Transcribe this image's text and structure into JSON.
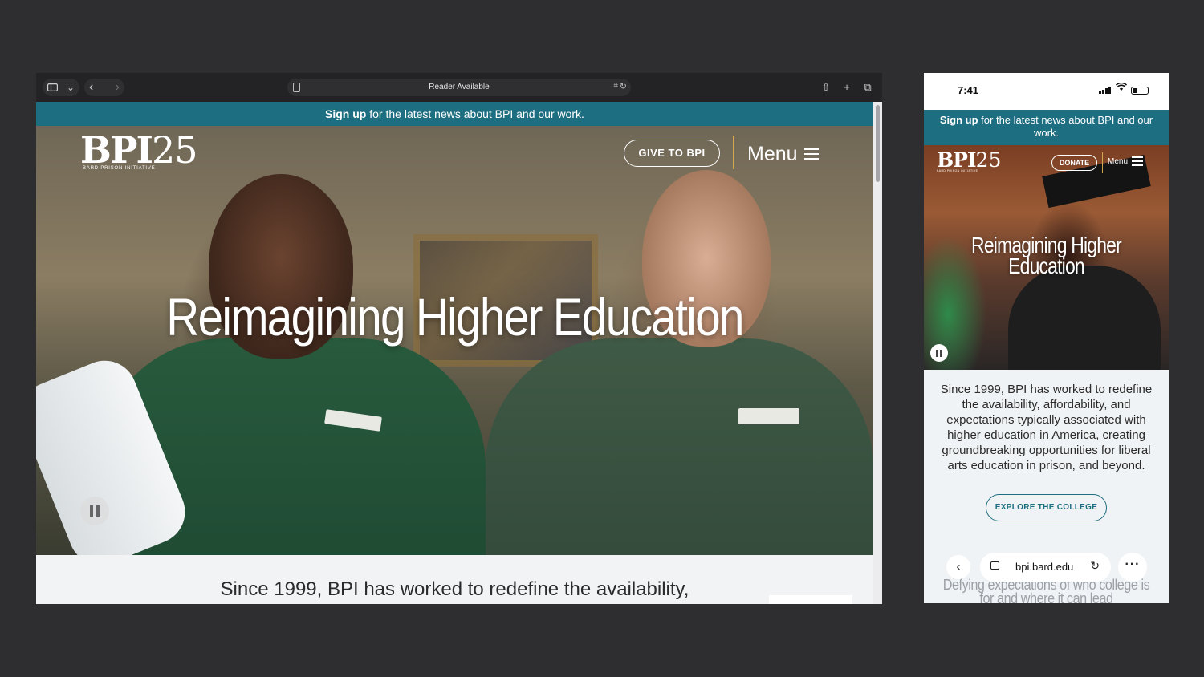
{
  "desktop": {
    "toolbar": {
      "sidebar_icon": "sidebar-icon",
      "chevron": "⌄",
      "back": "‹",
      "forward": "›",
      "address_text": "Reader Available",
      "translate": "⌗",
      "reload": "↻",
      "share": "⇧",
      "new_tab": "+",
      "tabs": "⧉"
    },
    "banner": {
      "bold": "Sign up",
      "text": " for the latest news about BPI and our work."
    },
    "logo": {
      "mark": "BPI",
      "number": "25",
      "subtitle": "BARD PRISON INITIATIVE"
    },
    "nav": {
      "give_label": "GIVE TO BPI",
      "menu_label": "Menu"
    },
    "hero_title": "Reimagining Higher Education",
    "intro_text": "Since 1999, BPI has worked to redefine the availability,"
  },
  "mobile": {
    "status": {
      "time": "7:41",
      "wifi": "wifi-icon",
      "battery": "battery-icon"
    },
    "banner": {
      "bold": "Sign up",
      "text": " for the latest news about BPI and our work."
    },
    "logo": {
      "mark": "BPI",
      "number": "25",
      "subtitle": "BARD PRISON INITIATIVE"
    },
    "nav": {
      "donate_label": "DONATE",
      "menu_label": "Menu"
    },
    "hero_title": "Reimagining Higher Education",
    "intro_text": "Since 1999, BPI has worked to redefine the availability, affordability, and expectations typically associated with higher education in America, creating groundbreaking opportunities for liberal arts education in prison, and beyond.",
    "explore_label": "EXPLORE THE COLLEGE",
    "browser": {
      "back": "‹",
      "domain": "bpi.bard.edu",
      "reload": "↻",
      "more": "···"
    },
    "fade_text": "Defying expectations of who college is for and where it can lead"
  },
  "colors": {
    "teal": "#1d6e80",
    "gold": "#d1a84b",
    "background": "#2e2e30"
  }
}
